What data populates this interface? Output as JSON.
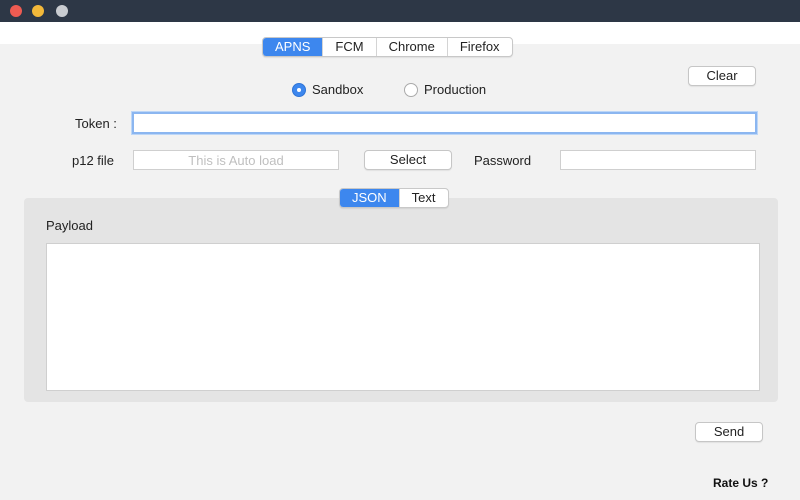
{
  "tabs": {
    "platform": [
      "APNS",
      "FCM",
      "Chrome",
      "Firefox"
    ],
    "format": [
      "JSON",
      "Text"
    ]
  },
  "environment": {
    "sandbox": "Sandbox",
    "production": "Production",
    "selected": "Sandbox"
  },
  "buttons": {
    "clear": "Clear",
    "select": "Select",
    "send": "Send"
  },
  "form": {
    "token_label": "Token :",
    "token_value": "",
    "p12_label": "p12 file",
    "p12_placeholder": "This is Auto load",
    "password_label": "Password",
    "password_value": ""
  },
  "payload": {
    "label": "Payload",
    "value": ""
  },
  "footer": {
    "rate_us": "Rate Us ?"
  },
  "colors": {
    "accent": "#3d87ee",
    "close": "#ee5b52",
    "minimize": "#f3b93a"
  },
  "icons": [
    "close-window-icon",
    "minimize-window-icon",
    "zoom-window-icon"
  ]
}
